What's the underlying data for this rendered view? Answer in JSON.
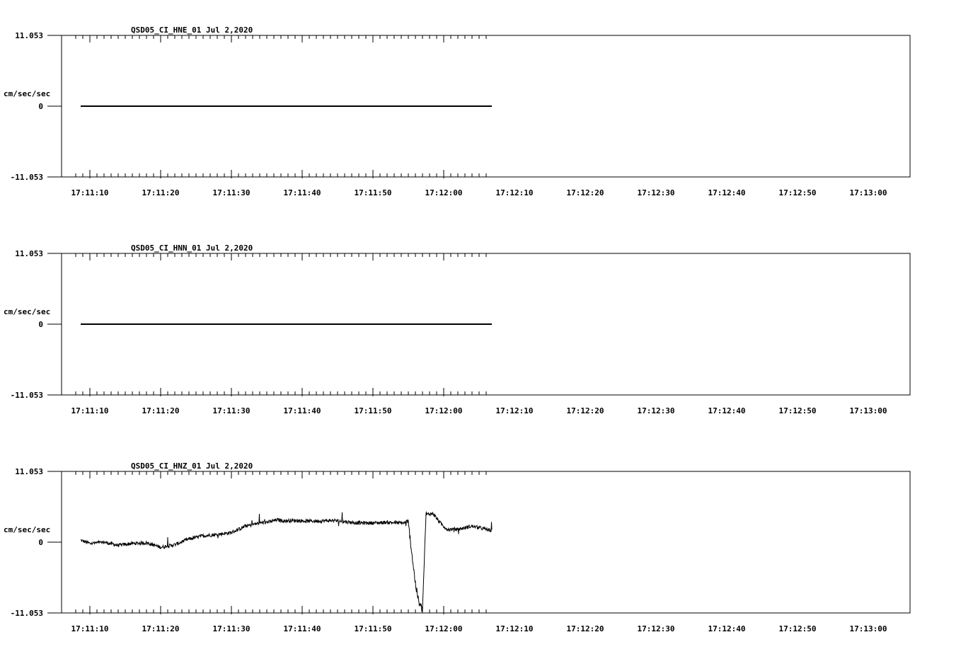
{
  "chart_data": [
    {
      "type": "line",
      "title": "QSD05_CI_HNE_01  Jul 2,2020",
      "ylabel": "cm/sec/sec",
      "ylim": [
        -11.053,
        11.053
      ],
      "y_tick_labels": [
        "11.053",
        "0",
        "-11.053"
      ],
      "x_tick_labels": [
        "17:11:10",
        "17:11:20",
        "17:11:30",
        "17:11:40",
        "17:11:50",
        "17:12:00",
        "17:12:10",
        "17:12:20",
        "17:12:30",
        "17:12:40",
        "17:12:50",
        "17:13:00"
      ],
      "xlim_seconds": [
        -2.6,
        56.8
      ],
      "series": [
        {
          "style": "flat",
          "x": [
            -1.3,
            56.8
          ],
          "y": [
            0,
            0
          ]
        }
      ]
    },
    {
      "type": "line",
      "title": "QSD05_CI_HNN_01  Jul 2,2020",
      "ylabel": "cm/sec/sec",
      "ylim": [
        -11.053,
        11.053
      ],
      "y_tick_labels": [
        "11.053",
        "0",
        "-11.053"
      ],
      "x_tick_labels": [
        "17:11:10",
        "17:11:20",
        "17:11:30",
        "17:11:40",
        "17:11:50",
        "17:12:00",
        "17:12:10",
        "17:12:20",
        "17:12:30",
        "17:12:40",
        "17:12:50",
        "17:13:00"
      ],
      "xlim_seconds": [
        -2.6,
        56.8
      ],
      "series": [
        {
          "style": "flat",
          "x": [
            -1.3,
            56.8
          ],
          "y": [
            0,
            0
          ]
        }
      ]
    },
    {
      "type": "line",
      "title": "QSD05_CI_HNZ_01  Jul 2,2020",
      "ylabel": "cm/sec/sec",
      "ylim": [
        -11.053,
        11.053
      ],
      "y_tick_labels": [
        "11.053",
        "0",
        "-11.053"
      ],
      "x_tick_labels": [
        "17:11:10",
        "17:11:20",
        "17:11:30",
        "17:11:40",
        "17:11:50",
        "17:12:00",
        "17:12:10",
        "17:12:20",
        "17:12:30",
        "17:12:40",
        "17:12:50",
        "17:13:00"
      ],
      "xlim_seconds": [
        -2.6,
        56.8
      ],
      "series": [
        {
          "style": "noisy",
          "x": [
            -1.3,
            0.0,
            2.0,
            4.0,
            6.0,
            8.0,
            10.0,
            12.0,
            14.0,
            16.0,
            18.0,
            20.0,
            22.0,
            24.0,
            25.5,
            26.5,
            27.5,
            28.5,
            30.5,
            32.5,
            34.5,
            36.0,
            38.0,
            40.0,
            42.0,
            44.0,
            45.0,
            46.0,
            46.5,
            47.0,
            47.5,
            48.5,
            49.5,
            50.5,
            52.0,
            54.0,
            56.8
          ],
          "y": [
            0.3,
            -0.2,
            0.0,
            -0.5,
            -0.2,
            -0.1,
            -0.8,
            -0.4,
            0.5,
            1.0,
            1.2,
            1.5,
            2.5,
            3.0,
            3.2,
            3.5,
            3.3,
            3.4,
            3.3,
            3.3,
            3.4,
            3.2,
            3.0,
            3.0,
            3.1,
            3.0,
            3.0,
            -6.5,
            -9.5,
            -10.6,
            4.3,
            4.5,
            3.0,
            2.0,
            2.0,
            2.5,
            1.8
          ]
        }
      ]
    }
  ]
}
